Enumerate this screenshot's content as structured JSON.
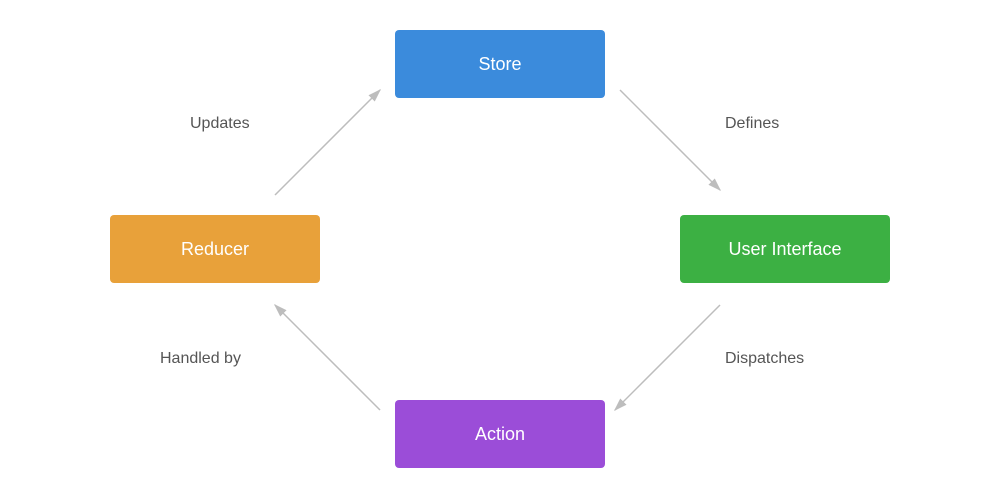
{
  "diagram": {
    "nodes": {
      "store": {
        "label": "Store",
        "color": "#3b8bdc"
      },
      "ui": {
        "label": "User Interface",
        "color": "#3cb043"
      },
      "action": {
        "label": "Action",
        "color": "#9b4dd8"
      },
      "reducer": {
        "label": "Reducer",
        "color": "#e8a13a"
      }
    },
    "edges": {
      "store_to_ui": {
        "label": "Defines"
      },
      "ui_to_action": {
        "label": "Dispatches"
      },
      "action_to_reducer": {
        "label": "Handled by"
      },
      "reducer_to_store": {
        "label": "Updates"
      }
    }
  }
}
